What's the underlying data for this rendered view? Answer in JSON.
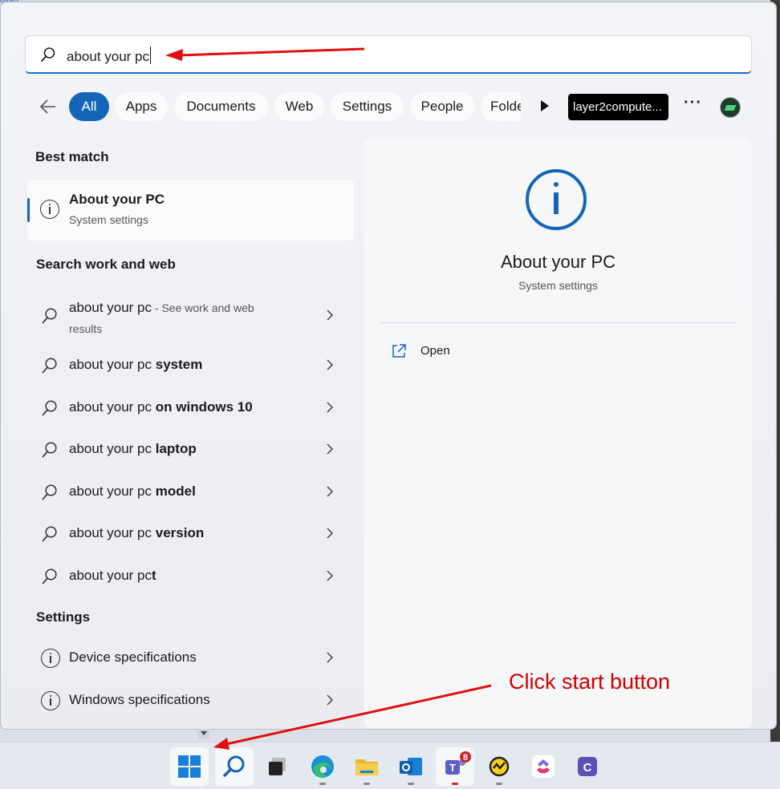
{
  "background": {
    "folder_label": "older"
  },
  "search": {
    "value": "about your pc"
  },
  "filters": {
    "chips": [
      {
        "label": "All",
        "active": true
      },
      {
        "label": "Apps",
        "active": false
      },
      {
        "label": "Documents",
        "active": false
      },
      {
        "label": "Web",
        "active": false
      },
      {
        "label": "Settings",
        "active": false
      },
      {
        "label": "People",
        "active": false
      },
      {
        "label": "Folde",
        "active": false
      }
    ],
    "user_label": "layer2compute..."
  },
  "best_match": {
    "section_title": "Best match",
    "title": "About your PC",
    "subtitle": "System settings"
  },
  "web_search": {
    "section_title": "Search work and web",
    "first": {
      "query": "about your pc",
      "suffix": " - See work and web",
      "suffix2": "results"
    },
    "items": [
      {
        "prefix": "about your pc ",
        "bold": "system"
      },
      {
        "prefix": "about your pc ",
        "bold": "on windows 10"
      },
      {
        "prefix": "about your pc ",
        "bold": "laptop"
      },
      {
        "prefix": "about your pc ",
        "bold": "model"
      },
      {
        "prefix": "about your pc ",
        "bold": "version"
      },
      {
        "prefix": "about your pc",
        "bold": "t"
      }
    ]
  },
  "settings": {
    "section_title": "Settings",
    "items": [
      "Device specifications",
      "Windows specifications"
    ]
  },
  "detail": {
    "title": "About your PC",
    "subtitle": "System settings",
    "open_label": "Open"
  },
  "annotation": {
    "text": "Click start button",
    "color": "#d10000"
  },
  "colors": {
    "accent": "#1465b8"
  },
  "taskbar": {
    "icons": [
      "start-icon",
      "search-icon",
      "task-view-icon",
      "edge-icon",
      "file-explorer-icon",
      "outlook-icon",
      "teams-icon",
      "app-icon",
      "clickup-icon",
      "app-c-icon"
    ],
    "teams_badge": "8"
  }
}
